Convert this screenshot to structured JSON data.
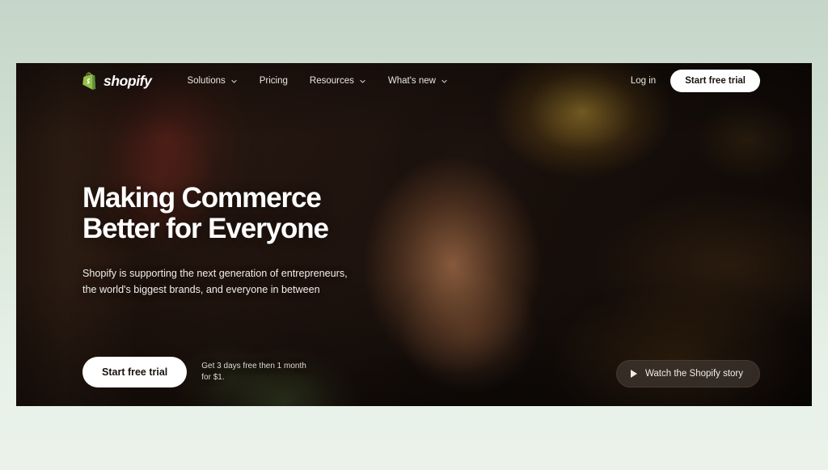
{
  "page": {
    "background_top_color": "#c5d6c9",
    "background_bottom_color": "#eaf2ea"
  },
  "header": {
    "logo": {
      "name": "shopify",
      "wordmark": "shopify",
      "brand_color": "#95BF47",
      "bag_color": "#5E8E3E"
    },
    "nav": [
      {
        "label": "Solutions",
        "has_dropdown": true
      },
      {
        "label": "Pricing",
        "has_dropdown": false
      },
      {
        "label": "Resources",
        "has_dropdown": true
      },
      {
        "label": "What's new",
        "has_dropdown": true
      }
    ],
    "login_label": "Log in",
    "start_trial_label": "Start free trial"
  },
  "hero": {
    "title_line1": "Making Commerce",
    "title_line2": "Better for Everyone",
    "subtitle_line1": "Shopify is supporting the next generation of entrepreneurs,",
    "subtitle_line2": "the world's biggest brands, and everyone in between",
    "cta_label": "Start free trial",
    "cta_note": "Get 3 days free then 1 month for $1.",
    "watch_label": "Watch the Shopify story",
    "media_description": "Warmly lit interior video still of a man speaking, with blurred framed artwork, a green plant and amber shelving behind him",
    "overlay_text_color": "#ffffff",
    "background_base_color": "#1b110b"
  }
}
